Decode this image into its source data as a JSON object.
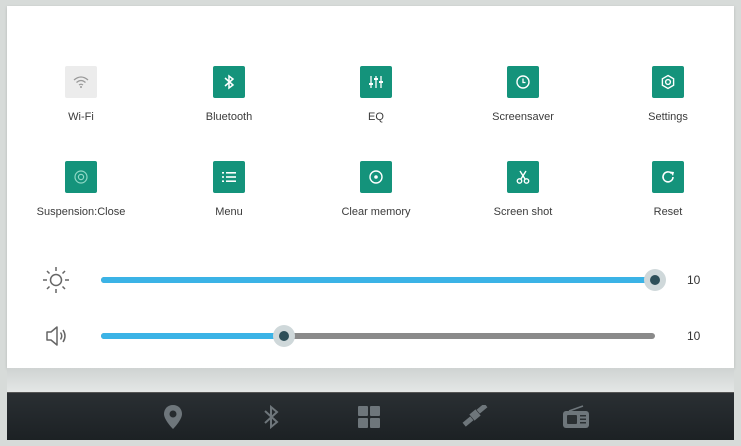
{
  "quick_tiles": [
    {
      "label": "Wi-Fi",
      "icon": "wifi-icon",
      "active": false
    },
    {
      "label": "Bluetooth",
      "icon": "bluetooth-icon",
      "active": true
    },
    {
      "label": "EQ",
      "icon": "equalizer-icon",
      "active": true
    },
    {
      "label": "Screensaver",
      "icon": "clock-icon",
      "active": true
    },
    {
      "label": "Settings",
      "icon": "gear-icon",
      "active": true
    },
    {
      "label": "Suspension:Close",
      "icon": "suspension-icon",
      "active": true
    },
    {
      "label": "Menu",
      "icon": "list-icon",
      "active": true
    },
    {
      "label": "Clear memory",
      "icon": "clear-memory-icon",
      "active": true
    },
    {
      "label": "Screen shot",
      "icon": "scissors-icon",
      "active": true
    },
    {
      "label": "Reset",
      "icon": "refresh-icon",
      "active": true
    }
  ],
  "brightness": {
    "icon": "sun-icon",
    "value_label": "10",
    "level": 1.0
  },
  "volume": {
    "icon": "speaker-icon",
    "value_label": "10",
    "level": 0.33
  },
  "bottom_bar": [
    "location-pin-icon",
    "bluetooth-icon",
    "apps-grid-icon",
    "satellite-icon",
    "radio-icon"
  ],
  "colors": {
    "accent_tile": "#14937b",
    "slider_fill": "#3bb3e6"
  }
}
